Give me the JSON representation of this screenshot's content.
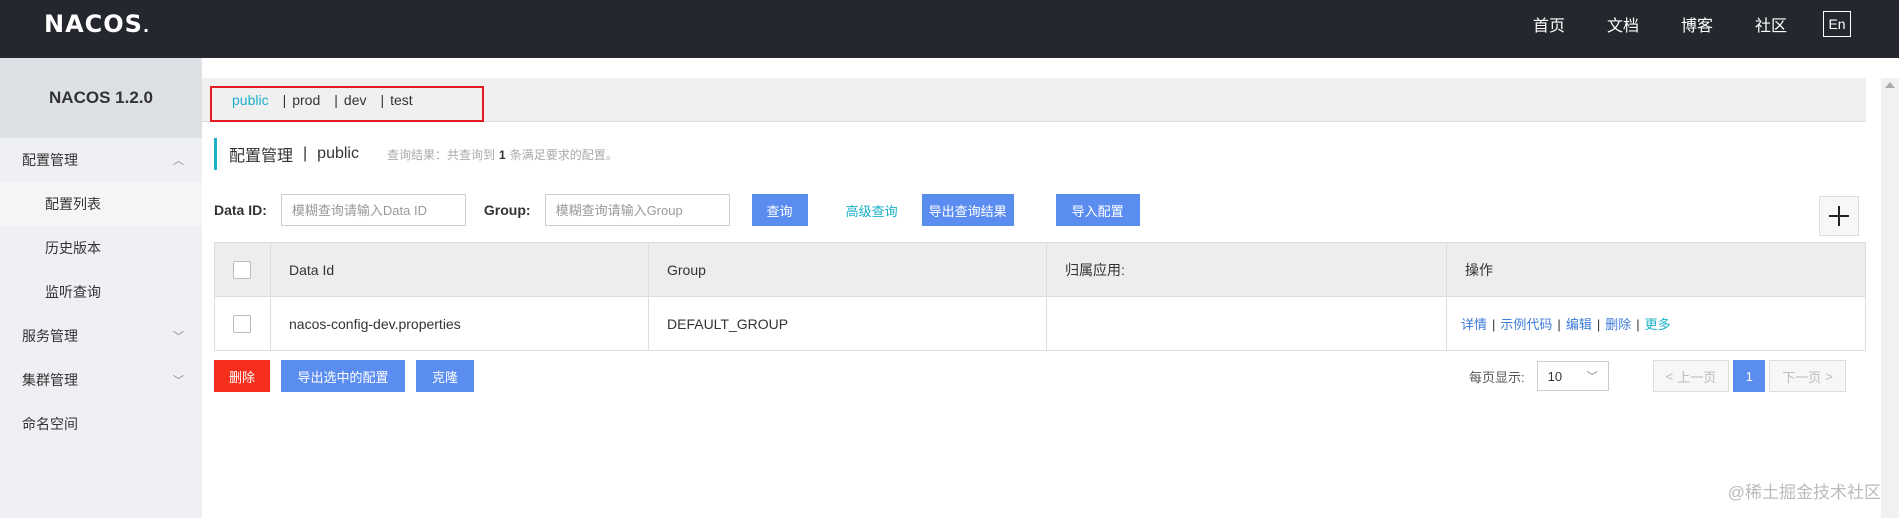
{
  "app": {
    "logo": "NACOS",
    "logo_dot": "."
  },
  "topnav": {
    "home": "首页",
    "docs": "文档",
    "blog": "博客",
    "community": "社区",
    "lang": "En"
  },
  "sidebar": {
    "title": "NACOS 1.2.0",
    "config_group": "配置管理",
    "config_list": "配置列表",
    "history": "历史版本",
    "listener": "监听查询",
    "service_group": "服务管理",
    "cluster_group": "集群管理",
    "namespace": "命名空间"
  },
  "namespaces": {
    "items": [
      "public",
      "prod",
      "dev",
      "test"
    ],
    "sep": "|",
    "active": "public"
  },
  "header": {
    "title": "配置管理",
    "sep": "|",
    "namespace": "public",
    "info_prefix": "查询结果：共查询到",
    "info_count": "1",
    "info_suffix": "条满足要求的配置。"
  },
  "filters": {
    "data_id_label": "Data ID:",
    "data_id_placeholder": "模糊查询请输入Data ID",
    "group_label": "Group:",
    "group_placeholder": "模糊查询请输入Group",
    "search_btn": "查询",
    "advanced": "高级查询",
    "export_results": "导出查询结果",
    "import": "导入配置"
  },
  "table": {
    "headers": [
      "Data Id",
      "Group",
      "归属应用:",
      "操作"
    ],
    "rows": [
      {
        "data_id": "nacos-config-dev.properties",
        "group": "DEFAULT_GROUP",
        "app": ""
      }
    ],
    "ops": {
      "detail": "详情",
      "sample": "示例代码",
      "edit": "编辑",
      "delete": "删除",
      "more": "更多",
      "sep": "|"
    }
  },
  "bottom": {
    "delete": "删除",
    "export_selected": "导出选中的配置",
    "clone": "克隆"
  },
  "pager": {
    "label": "每页显示:",
    "size": "10",
    "prev": "上一页",
    "current": "1",
    "next": "下一页"
  },
  "watermark": "@稀土掘金技术社区",
  "colors": {
    "topbar": "#24272d",
    "accent": "#1ab0c7",
    "primary_btn": "#5b8df0",
    "danger_btn": "#f52f1c",
    "highlight_box": "#e01b22"
  }
}
